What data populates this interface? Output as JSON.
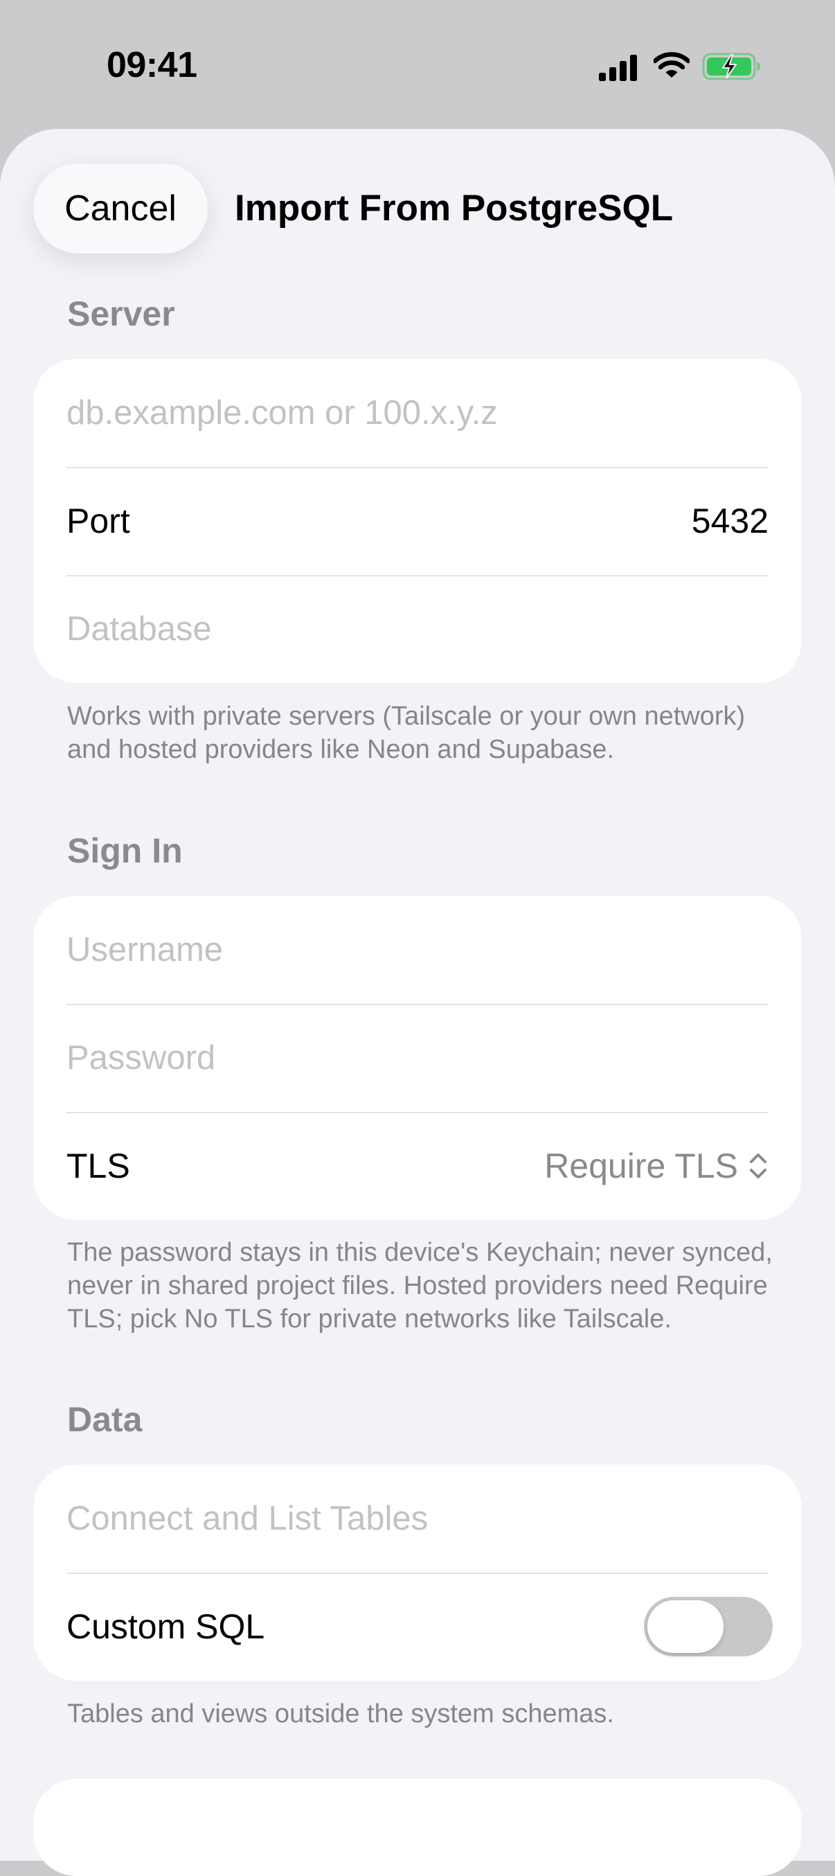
{
  "status_bar": {
    "time": "09:41",
    "battery_color": "#34c759"
  },
  "nav": {
    "cancel_label": "Cancel",
    "title": "Import From PostgreSQL"
  },
  "server": {
    "header": "Server",
    "host_placeholder": "db.example.com or 100.x.y.z",
    "port_label": "Port",
    "port_value": "5432",
    "database_placeholder": "Database",
    "footer": "Works with private servers (Tailscale or your own network) and hosted providers like Neon and Supabase."
  },
  "sign_in": {
    "header": "Sign In",
    "username_placeholder": "Username",
    "password_placeholder": "Password",
    "tls_label": "TLS",
    "tls_value": "Require TLS",
    "footer": "The password stays in this device's Keychain; never synced, never in shared project files. Hosted providers need Require TLS; pick No TLS for private networks like Tailscale."
  },
  "data": {
    "header": "Data",
    "connect_label": "Connect and List Tables",
    "custom_sql_label": "Custom SQL",
    "custom_sql_enabled": false,
    "footer": "Tables and views outside the system schemas."
  }
}
